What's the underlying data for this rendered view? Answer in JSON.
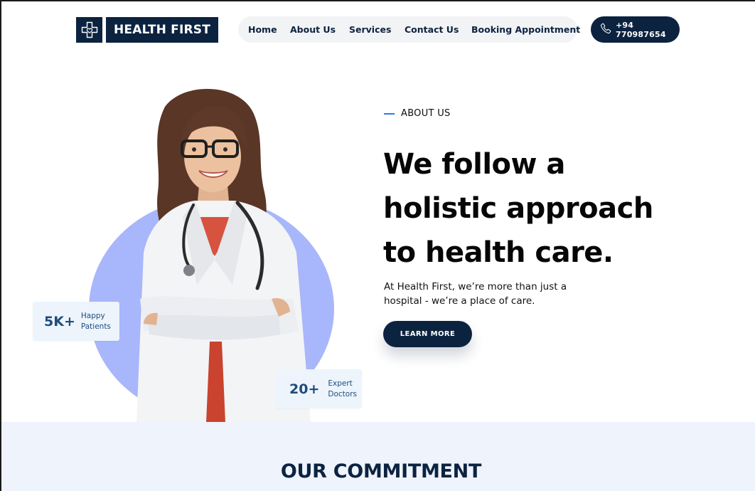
{
  "brand": {
    "name": "HEALTH FIRST",
    "logo_icon": "medical-cross-heart-icon"
  },
  "nav": {
    "items": [
      {
        "label": "Home"
      },
      {
        "label": "About Us"
      },
      {
        "label": "Services"
      },
      {
        "label": "Contact Us"
      },
      {
        "label": "Booking Appointment"
      }
    ]
  },
  "phone": {
    "icon": "phone-icon",
    "number": "+94 770987654"
  },
  "hero": {
    "eyebrow": "ABOUT US",
    "headline": [
      "We follow a",
      "holistic approach",
      "to health care."
    ],
    "description": "At Health First, we’re more than just a hospital - we’re a place of care.",
    "cta_label": "LEARN MORE"
  },
  "stats": {
    "patients": {
      "value": "5K+",
      "label_line1": "Happy",
      "label_line2": "Patients"
    },
    "doctors": {
      "value": "20+",
      "label_line1": "Expert",
      "label_line2": "Doctors"
    }
  },
  "commitment": {
    "title": "OUR COMMITMENT"
  },
  "colors": {
    "navy": "#0c2340",
    "accent_blue": "#2b7de9",
    "circle_lavender": "#a8b6fb",
    "stat_bg": "#edf4fc",
    "section_bg": "#eef3fc"
  }
}
